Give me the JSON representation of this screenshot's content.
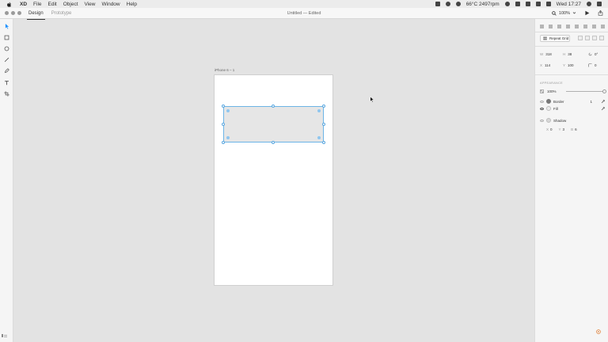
{
  "menubar": {
    "menus": [
      "XD",
      "File",
      "Edit",
      "Object",
      "View",
      "Window",
      "Help"
    ],
    "status_weather": "66°C 2497rpm",
    "clock": "Wed 17:27"
  },
  "toolbar": {
    "tabs": [
      "Design",
      "Prototype"
    ],
    "active_tab": "Design",
    "doc_title": "Untitled — Edited",
    "zoom": "100%"
  },
  "tools": [
    "select-tool",
    "rectangle-tool",
    "ellipse-tool",
    "line-tool",
    "pen-tool",
    "text-tool",
    "artboard-tool"
  ],
  "canvas": {
    "artboard_label": "iPhone 6 – 1"
  },
  "inspector": {
    "repeat_grid_label": "Repeat Grid",
    "w_label": "W",
    "w_value": "318",
    "h_label": "H",
    "h_value": "38",
    "rotation_value": "0°",
    "x_label": "X",
    "x_value": "114",
    "y_label": "Y",
    "y_value": "100",
    "radius_value": "0",
    "appearance_title": "APPEARANCE",
    "opacity": "100%",
    "border_label": "Border",
    "border_width": "1",
    "fill_label": "Fill",
    "shadow_label": "Shadow",
    "shadow_x_label": "X",
    "shadow_x": "0",
    "shadow_y_label": "Y",
    "shadow_y": "3",
    "shadow_b_label": "B",
    "shadow_b": "6"
  },
  "colors": {
    "selection": "#5ba8e0",
    "shape_fill": "#e6e6e6",
    "canvas_bg": "#e3e3e3",
    "artboard_bg": "#ffffff"
  }
}
